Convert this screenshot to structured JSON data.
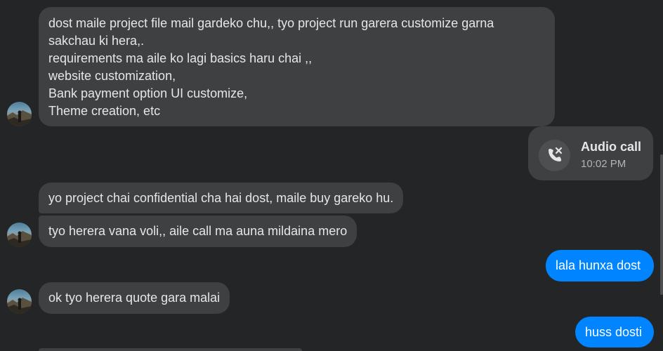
{
  "messages": {
    "m1": {
      "lines": [
        "dost maile project file mail gardeko chu,, tyo project run garera customize garna",
        "sakchau ki hera,.",
        "requirements ma aile ko lagi basics haru chai ,,",
        "website customization,",
        "Bank payment option UI customize,",
        "Theme creation, etc"
      ]
    },
    "call": {
      "title": "Audio call",
      "time": "10:02 PM",
      "icon": "missed-call-icon"
    },
    "m2": {
      "text": "yo project chai confidential cha hai dost, maile buy gareko hu."
    },
    "m3": {
      "text": "tyo herera vana voli,, aile call ma auna mildaina mero"
    },
    "m4": {
      "text": "lala hunxa dost"
    },
    "m5": {
      "text": "ok tyo herera quote gara malai"
    },
    "m6": {
      "text": "huss dosti"
    }
  },
  "colors": {
    "background": "#242526",
    "incoming_bubble": "#3e4042",
    "outgoing_bubble": "#0084ff",
    "text": "#e4e6eb",
    "secondary_text": "#b0b3b8"
  },
  "avatar_icon": "user-avatar-icon"
}
